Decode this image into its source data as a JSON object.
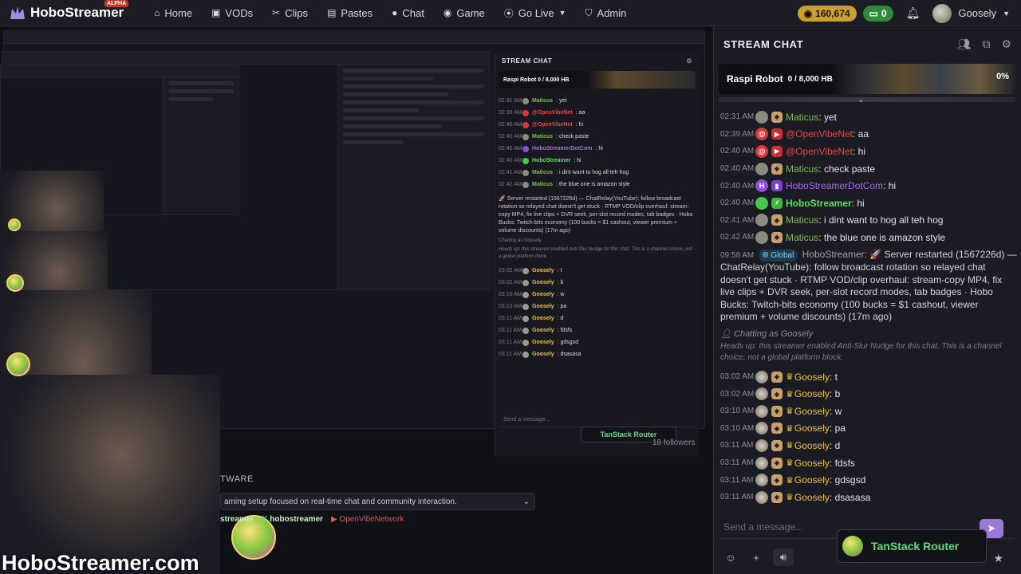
{
  "brand": {
    "name": "HoboStreamer",
    "badge": "ALPHA"
  },
  "nav": [
    {
      "label": "Home",
      "icon": "home-icon"
    },
    {
      "label": "VODs",
      "icon": "video-icon"
    },
    {
      "label": "Clips",
      "icon": "scissors-icon"
    },
    {
      "label": "Pastes",
      "icon": "paste-icon"
    },
    {
      "label": "Chat",
      "icon": "chat-icon"
    },
    {
      "label": "Game",
      "icon": "gamepad-icon"
    },
    {
      "label": "Go Live",
      "icon": "broadcast-icon"
    },
    {
      "label": "Admin",
      "icon": "shield-icon"
    }
  ],
  "user": {
    "coins": "160,674",
    "green_count": "0",
    "name": "Goosely"
  },
  "stream": {
    "watermark": "HoboStreamer.com",
    "tware_label": "TWARE",
    "about": "aming setup focused on real-time chat and community interaction.",
    "tag1": "streamer",
    "tag2": "hobostreamer",
    "tag3": "OpenVibeNetwork",
    "followers": "18 followers"
  },
  "chat": {
    "title": "STREAM CHAT",
    "banner_title": "Raspi Robot",
    "banner_sub": "0 / 8,000 HB",
    "banner_pct": "0%",
    "messages": [
      {
        "time": "02:31 AM",
        "name": "Maticus",
        "text": ": yet",
        "color": "#7fbf4a",
        "ava": "#8a8a80",
        "shield": "#c8a070"
      },
      {
        "time": "02:39 AM",
        "name": "@OpenVibeNet",
        "text": ": aa",
        "color": "#e04848",
        "ava": "#d83a3a",
        "shield": "#c83030"
      },
      {
        "time": "02:40 AM",
        "name": "@OpenVibeNet",
        "text": ": hi",
        "color": "#e04848",
        "ava": "#d83a3a",
        "shield": "#c83030"
      },
      {
        "time": "02:40 AM",
        "name": "Maticus",
        "text": ": check paste",
        "color": "#7fbf4a",
        "ava": "#8a8a80",
        "shield": "#c8a070"
      },
      {
        "time": "02:40 AM",
        "name": "HoboStreamerDotCom",
        "text": ": hi",
        "color": "#a86ae8",
        "ava": "#8f4ae0",
        "shield": "#7a40d0"
      },
      {
        "time": "02:40 AM",
        "name": "HoboStreamer",
        "text": ": hi",
        "color": "#5ce060",
        "ava": "#48c848",
        "shield": "#3ab840"
      },
      {
        "time": "02:41 AM",
        "name": "Maticus",
        "text": ": i dint want to hog all teh hog",
        "color": "#7fbf4a",
        "ava": "#8a8a80",
        "shield": "#c8a070"
      },
      {
        "time": "02:42 AM",
        "name": "Maticus",
        "text": ": the blue one is amazon style",
        "color": "#7fbf4a",
        "ava": "#8a8a80",
        "shield": "#c8a070"
      }
    ],
    "system": {
      "time": "09:58 AM",
      "badge": "Global",
      "author": "HoboStreamer:",
      "text": "🚀 Server restarted (1567226d) — ChatRelay(YouTube): follow broadcast rotation so relayed chat doesn't get stuck · RTMP VOD/clip overhaul: stream-copy MP4, fix live clips + DVR seek, per-slot record modes, tab badges · Hobo Bucks: Twitch-bits economy (100 bucks = $1 cashout, viewer premium + volume discounts) (17m ago)"
    },
    "chatting_as": "Chatting as Goosely",
    "notice": "Heads up: this streamer enabled Anti-Slur Nudge for this chat. This is a channel choice, not a global platform block.",
    "user_messages": [
      {
        "time": "03:02 AM",
        "name": "Goosely",
        "text": ": t"
      },
      {
        "time": "03:02 AM",
        "name": "Goosely",
        "text": ": b"
      },
      {
        "time": "03:10 AM",
        "name": "Goosely",
        "text": ": w"
      },
      {
        "time": "03:10 AM",
        "name": "Goosely",
        "text": ": pa"
      },
      {
        "time": "03:11 AM",
        "name": "Goosely",
        "text": ": d"
      },
      {
        "time": "03:11 AM",
        "name": "Goosely",
        "text": ": fdsfs"
      },
      {
        "time": "03:11 AM",
        "name": "Goosely",
        "text": ": gdsgsd"
      },
      {
        "time": "03:11 AM",
        "name": "Goosely",
        "text": ": dsasasa"
      }
    ],
    "input_placeholder": "Send a message...",
    "tanstack_label": "TanStack Router"
  },
  "mid_chat": {
    "title": "STREAM CHAT",
    "banner": "Raspi Robot  0 / 8,000 HB",
    "placeholder": "Send a message...",
    "tanstack_label": "TanStack Router"
  },
  "colors": {
    "accent": "#9a7ad6",
    "coins": "#caa033",
    "green": "#2d8b3a",
    "goosely": "#f0c030"
  }
}
